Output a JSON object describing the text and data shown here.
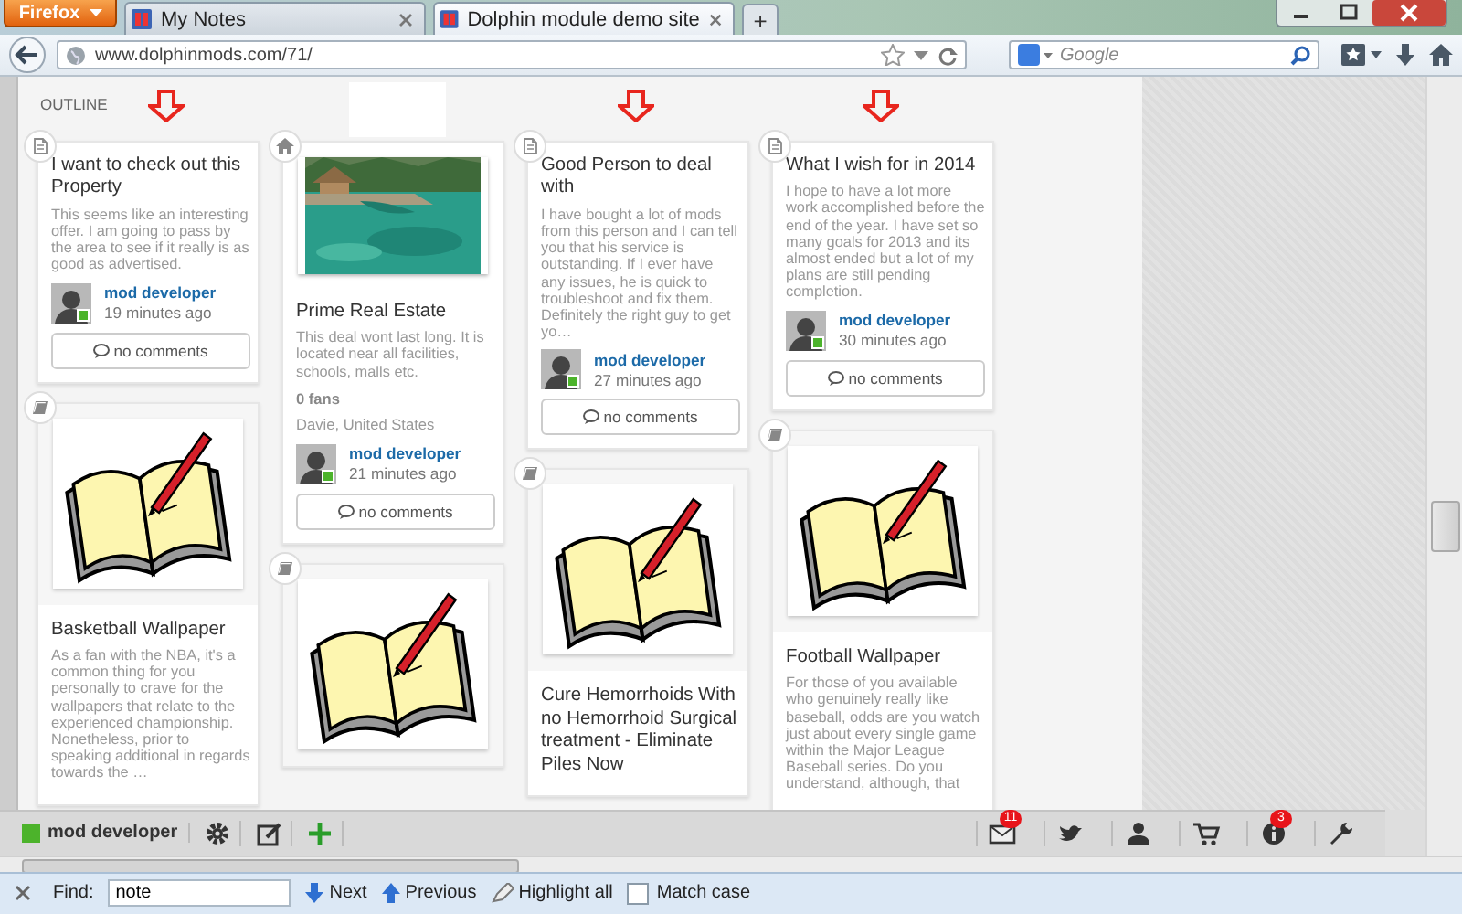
{
  "browser": {
    "menu_button": "Firefox",
    "tabs": [
      {
        "title": "My Notes",
        "selected": false
      },
      {
        "title": "Dolphin module demo site",
        "selected": true
      }
    ],
    "new_tab_button": "+",
    "address": "www.dolphinmods.com/71/",
    "search": {
      "placeholder": "Google"
    }
  },
  "page": {
    "outline_label": "OUTLINE",
    "columns": [
      {
        "marked": true,
        "cards": [
          {
            "kind": "post",
            "title": "I want to check out this Property",
            "text": "This seems like an interesting offer. I am going to pass by the area to see if it really is as good as advertised.",
            "author": {
              "name": "mod developer",
              "online": true
            },
            "time": "19 minutes ago",
            "comments": "no comments"
          },
          {
            "kind": "media",
            "title": "Basketball Wallpaper",
            "text": "As a fan with the NBA, it's a common thing for you personally to crave for the wallpapers that relate to the experienced championship. Nonetheless, prior to speaking additional in regards towards the …"
          }
        ]
      },
      {
        "marked": false,
        "cards": [
          {
            "kind": "listing",
            "title": "Prime Real Estate",
            "text": "This deal wont last long. It is located near all facilities, schools, malls etc.",
            "fans": "0 fans",
            "location": "Davie, United States",
            "author": {
              "name": "mod developer",
              "online": true
            },
            "time": "21 minutes ago",
            "comments": "no comments"
          },
          {
            "kind": "media"
          }
        ]
      },
      {
        "marked": true,
        "cards": [
          {
            "kind": "post",
            "title": "Good Person to deal with",
            "text": "I have bought a lot of mods from this person and I can tell you that his service is outstanding. If I ever have any issues, he is quick to troubleshoot and fix them. Definitely the right guy to get yo…",
            "author": {
              "name": "mod developer",
              "online": true
            },
            "time": "27 minutes ago",
            "comments": "no comments"
          },
          {
            "kind": "media",
            "title": "Cure Hemorrhoids With no Hemorrhoid Surgical treatment - Eliminate Piles Now"
          }
        ]
      },
      {
        "marked": true,
        "cards": [
          {
            "kind": "post",
            "title": "What I wish for in 2014",
            "text": "I hope to have a lot more work accomplished before the end of the year. I have set so many goals for 2013 and its almost ended but a lot of my plans are still pending completion.",
            "author": {
              "name": "mod developer",
              "online": true
            },
            "time": "30 minutes ago",
            "comments": "no comments"
          },
          {
            "kind": "media",
            "title": "Football Wallpaper",
            "text": "For those of you available who genuinely really like baseball, odds are you watch just about every single game within the Major League Baseball series. Do you understand, although, that"
          }
        ]
      }
    ]
  },
  "toolbar": {
    "user": {
      "name": "mod developer",
      "online": true
    },
    "notifications": {
      "messages": "11",
      "info": "3"
    }
  },
  "find_bar": {
    "label": "Find:",
    "value": "note",
    "next": "Next",
    "previous": "Previous",
    "highlight_all": "Highlight all",
    "match_case": {
      "label": "Match case",
      "checked": false
    }
  }
}
